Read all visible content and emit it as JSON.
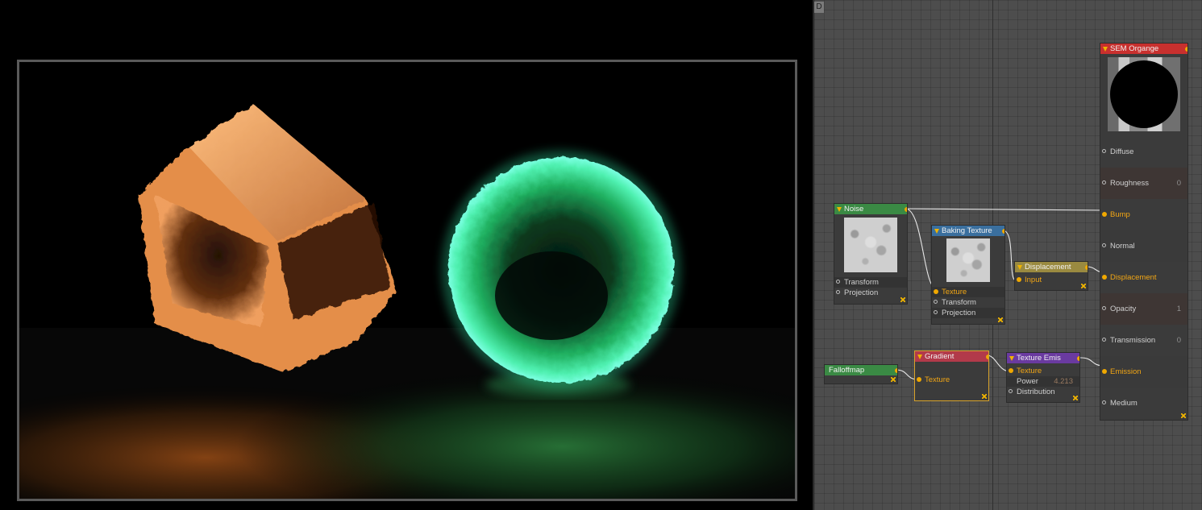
{
  "graph": {
    "badge": "D",
    "nodes": {
      "noise": {
        "title": "Noise",
        "color": "#3a8a44",
        "rows": [
          "Transform",
          "Projection"
        ]
      },
      "baking": {
        "title": "Baking Texture",
        "color": "#3a6f9e",
        "rows": [
          "Texture",
          "Transform",
          "Projection"
        ]
      },
      "displacement": {
        "title": "Displacement",
        "color": "#9a8a40",
        "rows": [
          "Input"
        ]
      },
      "falloff": {
        "title": "Falloffmap",
        "color": "#3a8a44"
      },
      "gradient": {
        "title": "Gradient",
        "color": "#b23a4a",
        "rows": [
          "Texture"
        ]
      },
      "emis": {
        "title": "Texture Emis",
        "color": "#6a3aa0",
        "rows": [
          "Texture",
          "Power",
          "Distribution"
        ],
        "power_value": "4.213"
      },
      "material": {
        "title": "SEM Organge",
        "color": "#c8302e",
        "rows": [
          {
            "label": "Diffuse",
            "value": ""
          },
          {
            "label": "Roughness",
            "value": "0"
          },
          {
            "label": "Bump",
            "value": ""
          },
          {
            "label": "Normal",
            "value": ""
          },
          {
            "label": "Displacement",
            "value": ""
          },
          {
            "label": "Opacity",
            "value": "1"
          },
          {
            "label": "Transmission",
            "value": "0"
          },
          {
            "label": "Emission",
            "value": ""
          },
          {
            "label": "Medium",
            "value": ""
          }
        ]
      }
    }
  },
  "render": {
    "cube_color": "#f5a45a",
    "sphere_color": "#3ef0a0",
    "floor_glow_left": "#7a3a10",
    "floor_glow_right": "#1f5a2a"
  }
}
